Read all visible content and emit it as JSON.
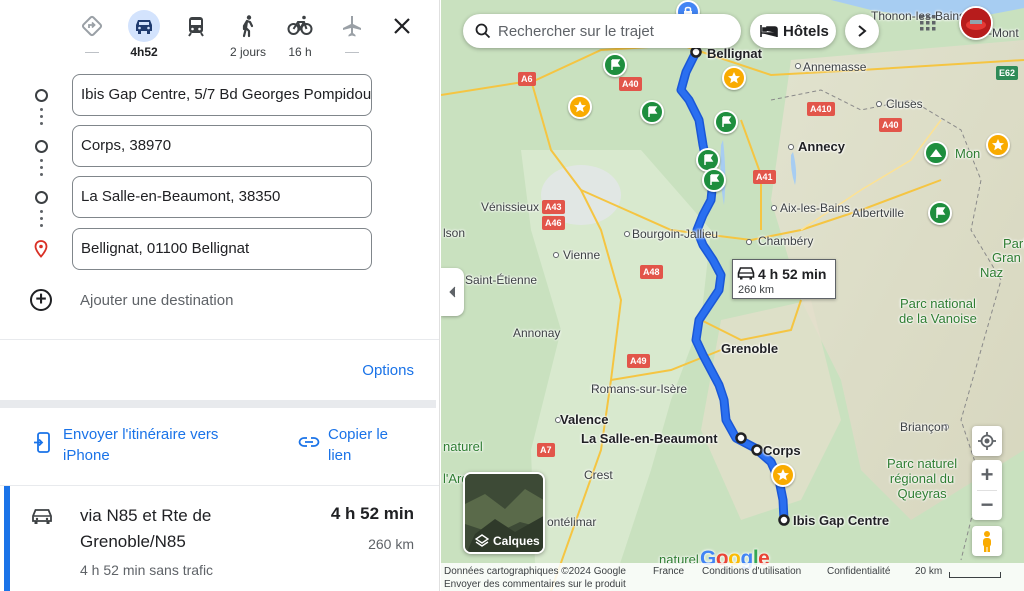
{
  "colors": {
    "route": "#1a73e8",
    "accent": "#1a73e8",
    "active_mode_bg": "#d3e3fd"
  },
  "travel_modes": [
    {
      "id": "best",
      "icon": "directions-diamond-icon",
      "label": "",
      "active": false
    },
    {
      "id": "car",
      "icon": "car-icon",
      "label": "4h52",
      "active": true
    },
    {
      "id": "transit",
      "icon": "train-icon",
      "label": "",
      "active": false
    },
    {
      "id": "walk",
      "icon": "walking-icon",
      "label": "2 jours",
      "active": false
    },
    {
      "id": "bike",
      "icon": "bicycle-icon",
      "label": "16 h",
      "active": false
    },
    {
      "id": "flight",
      "icon": "airplane-icon",
      "label": "",
      "active": false
    }
  ],
  "stops": [
    "Ibis Gap Centre, 5/7 Bd Georges Pompidou",
    "Corps, 38970",
    "La Salle-en-Beaumont, 38350",
    "Bellignat, 01100 Bellignat"
  ],
  "add_destination": "Ajouter une destination",
  "options_label": "Options",
  "share": {
    "send": "Envoyer l'itinéraire vers iPhone",
    "send_line1": "Envoyer l'itinéraire vers",
    "send_line2": "iPhone",
    "copy_line1": "Copier le",
    "copy_line2": "lien"
  },
  "route": {
    "via_line1": "via N85 et Rte de",
    "via_line2": "Grenoble/N85",
    "duration": "4 h 52 min",
    "distance": "260 km",
    "no_traffic": "4 h 52 min sans trafic"
  },
  "map": {
    "search_placeholder": "Rechercher sur le trajet",
    "hotels_label": "Hôtels",
    "layers_label": "Calques",
    "time_card": {
      "duration": "4 h 52 min",
      "distance": "260 km"
    },
    "google_logo": "Google",
    "places": [
      {
        "id": "bellignat",
        "name": "Bellignat"
      },
      {
        "id": "thonon",
        "name": "Thonon-les-Bains"
      },
      {
        "id": "annemasse",
        "name": "Annemasse"
      },
      {
        "id": "cluses",
        "name": "Cluses"
      },
      {
        "id": "annecy",
        "name": "Annecy"
      },
      {
        "id": "aixlesbains",
        "name": "Aix-les-Bains"
      },
      {
        "id": "albertville",
        "name": "Albertville"
      },
      {
        "id": "chambery",
        "name": "Chambéry"
      },
      {
        "id": "venissieux",
        "name": "Vénissieux"
      },
      {
        "id": "bourgoin",
        "name": "Bourgoin-Jallieu"
      },
      {
        "id": "vienne",
        "name": "Vienne"
      },
      {
        "id": "stetienne",
        "name": "Saint-Étienne"
      },
      {
        "id": "annonay",
        "name": "Annonay"
      },
      {
        "id": "grenoble",
        "name": "Grenoble"
      },
      {
        "id": "romans",
        "name": "Romans-sur-Isère"
      },
      {
        "id": "valence",
        "name": "Valence"
      },
      {
        "id": "lasalle",
        "name": "La Salle-en-Beaumont"
      },
      {
        "id": "corps",
        "name": "Corps"
      },
      {
        "id": "crest",
        "name": "Crest"
      },
      {
        "id": "ibisgap",
        "name": "Ibis Gap Centre"
      },
      {
        "id": "briancon",
        "name": "Briançon"
      },
      {
        "id": "montelimar",
        "name": "ontélimar"
      },
      {
        "id": "lson",
        "name": "lson"
      },
      {
        "id": "nat",
        "name": "naturel"
      },
      {
        "id": "ard",
        "name": "l'Ardèche"
      },
      {
        "id": "naturet",
        "name": "naturel"
      },
      {
        "id": "mont",
        "name": "Mon"
      },
      {
        "id": "gran",
        "name": "Gran"
      },
      {
        "id": "naz",
        "name": "Naz"
      },
      {
        "id": "sm",
        "name": "-Mont"
      },
      {
        "id": "pari",
        "name": "Pari"
      }
    ],
    "parks": [
      {
        "id": "vanoise",
        "line1": "Parc national",
        "line2": "de la Vanoise"
      },
      {
        "id": "queyras",
        "line1": "Parc naturel",
        "line2": "régional du",
        "line3": "Queyras"
      }
    ],
    "road_shields": [
      "A6",
      "A40",
      "A410",
      "A41",
      "A46",
      "A43",
      "A48",
      "A49",
      "A7",
      "E62",
      "A40"
    ],
    "footer": {
      "data": "Données cartographiques ©2024 Google",
      "country": "France",
      "terms": "Conditions d'utilisation",
      "privacy": "Confidentialité",
      "scale": "20 km",
      "feedback": "Envoyer des commentaires sur le produit"
    }
  }
}
